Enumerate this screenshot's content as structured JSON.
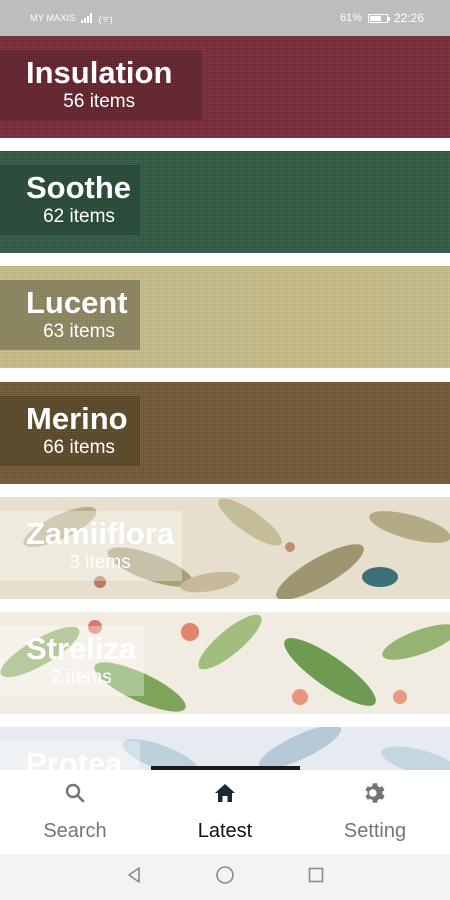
{
  "status_bar": {
    "carrier": "MY MAXIS",
    "battery": "61%",
    "time": "22:26",
    "battery_level": 0.61
  },
  "categories": [
    {
      "name": "Insulation",
      "count": "56 items",
      "color": "#7a2b37"
    },
    {
      "name": "Soothe",
      "count": "62 items",
      "color": "#2f5b43"
    },
    {
      "name": "Lucent",
      "count": "63 items",
      "color": "#c9c089"
    },
    {
      "name": "Merino",
      "count": "66 items",
      "color": "#725a33"
    },
    {
      "name": "Zamiiflora",
      "count": "3 items",
      "color": "#e6dfcd"
    },
    {
      "name": "Streliza",
      "count": "2 items",
      "color": "#f1ece1"
    },
    {
      "name": "Protea",
      "count": "",
      "color": "#e5ebf0"
    }
  ],
  "bottom_nav": {
    "items": [
      {
        "label": "Search",
        "icon": "search-icon"
      },
      {
        "label": "Latest",
        "icon": "home-icon"
      },
      {
        "label": "Setting",
        "icon": "gear-icon"
      }
    ],
    "active": "Latest"
  },
  "system_nav": {
    "buttons": [
      "back-icon",
      "home-circle-icon",
      "recents-icon"
    ]
  }
}
